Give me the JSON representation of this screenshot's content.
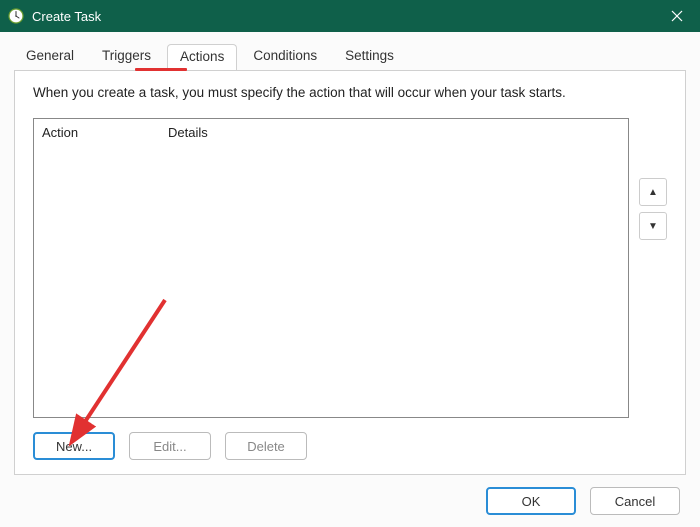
{
  "window": {
    "title": "Create Task"
  },
  "tabs": {
    "general": "General",
    "triggers": "Triggers",
    "actions": "Actions",
    "conditions": "Conditions",
    "settings": "Settings",
    "active": "actions"
  },
  "actionsTab": {
    "description": "When you create a task, you must specify the action that will occur when your task starts.",
    "columns": {
      "action": "Action",
      "details": "Details"
    },
    "buttons": {
      "new": "New...",
      "edit": "Edit...",
      "delete": "Delete"
    }
  },
  "dialog": {
    "ok": "OK",
    "cancel": "Cancel"
  },
  "icons": {
    "close": "✕",
    "arrowUp": "▲",
    "arrowDown": "▼"
  },
  "colors": {
    "titlebar": "#0f604a",
    "highlight": "#e13131",
    "buttonPrimary": "#2a8dd6"
  }
}
